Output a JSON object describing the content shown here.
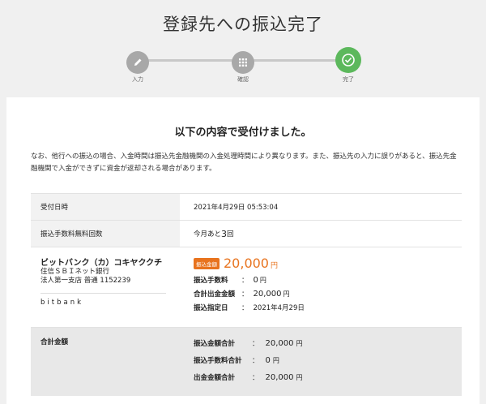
{
  "page": {
    "title": "登録先への振込完了"
  },
  "stepper": {
    "steps": [
      {
        "label": "入力",
        "icon": "pencil-icon",
        "state": "done"
      },
      {
        "label": "確認",
        "icon": "grid-icon",
        "state": "done"
      },
      {
        "label": "完了",
        "icon": "check-icon",
        "state": "active"
      }
    ],
    "active_color": "#5cb85c",
    "inactive_color": "#a8a8a8"
  },
  "card": {
    "heading": "以下の内容で受付けました。",
    "note": "なお、他行への振込の場合、入金時間は振込先金融機関の入金処理時間により異なります。また、振込先の入力に誤りがあると、振込先金融機関で入金ができずに資金が返却される場合があります。"
  },
  "table": {
    "receipt": {
      "label": "受付日時",
      "value": "2021年4月29日 05:53:04"
    },
    "free_fee": {
      "label": "振込手数料無料回数",
      "prefix": "今月あと",
      "count": "3",
      "suffix": "回"
    },
    "payee": {
      "name": "ビットバンク（カ）コキヤククチ",
      "bank": "住信ＳＢＩネット銀行",
      "branch": "法人第一支店 普通 1152239",
      "nickname": "bitbank",
      "badge": "振込金額",
      "amount": "20,000",
      "amount_unit": "円",
      "fee_label": "振込手数料",
      "fee_value": "0",
      "fee_unit": "円",
      "total_label": "合計出金金額",
      "total_value": "20,000",
      "total_unit": "円",
      "date_label": "振込指定日",
      "date_value": "2021年4月29日",
      "colon": "："
    },
    "summary": {
      "label": "合計金額",
      "rows": [
        {
          "label": "振込金額合計",
          "value": "20,000",
          "unit": "円"
        },
        {
          "label": "振込手数料合計",
          "value": "0",
          "unit": "円"
        },
        {
          "label": "出金金額合計",
          "value": "20,000",
          "unit": "円"
        }
      ],
      "colon": "："
    }
  },
  "colors": {
    "accent": "#e8731e",
    "success": "#5cb85c"
  }
}
